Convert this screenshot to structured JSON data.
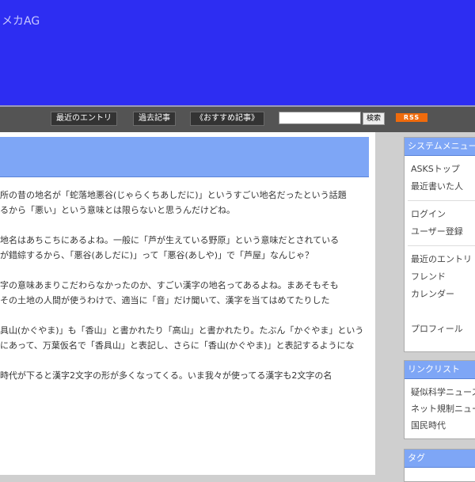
{
  "header": {
    "site_title": "メカAG"
  },
  "nav": {
    "items": [
      "最近のエントリ",
      "過去記事",
      "《おすすめ記事》"
    ],
    "search_placeholder": "",
    "search_button": "検索",
    "rss_label": "RSS"
  },
  "article": {
    "paragraphs": [
      [
        "所の昔の地名が「蛇落地悪谷(じゃらくちあしだに)」というすごい地名だったという話題",
        "るから「悪い」という意味とは限らないと思うんだけどね。"
      ],
      [
        "地名はあちこちにあるよね。一般に「芦が生えている野原」という意味だとされている",
        "が錯綜するから、「悪谷(あしだに)」って「悪谷(あしや)」で「芦屋」なんじゃ？"
      ],
      [
        "字の意味あまりこだわらなかったのか、すごい漢字の地名ってあるよね。まあそもそも",
        "その土地の人間が使うわけで、適当に「音」だけ聞いて、漢字を当てはめてたりした"
      ],
      [
        "具山(かぐやま)」も「香山」と書かれたり「高山」と書かれたり。たぶん「かぐやま」という",
        "にあって、万葉仮名で「香具山」と表記し、さらに「香山(かぐやま)」と表記するようにな"
      ],
      [
        "時代が下ると漢字2文字の形が多くなってくる。いま我々が使ってる漢字も2文字の名"
      ]
    ]
  },
  "sidebar": {
    "system_menu": {
      "title": "システムメニュー",
      "groups": [
        [
          "ASKSトップ",
          "最近書いた人"
        ],
        [
          "ログイン",
          "ユーザー登録"
        ],
        [
          "最近のエントリ",
          "フレンド",
          "カレンダー",
          "",
          "プロフィール"
        ]
      ]
    },
    "link_list": {
      "title": "リンクリスト",
      "items": [
        "疑似科学ニュース",
        "ネット規制ニュース",
        "国民時代"
      ]
    },
    "tags": {
      "title": "タグ"
    }
  }
}
